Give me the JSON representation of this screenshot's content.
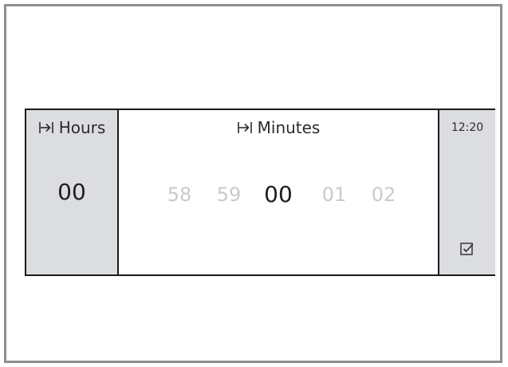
{
  "hours": {
    "header_label": "Hours",
    "value": "00"
  },
  "minutes": {
    "header_label": "Minutes",
    "options": [
      "58",
      "59",
      "00",
      "01",
      "02"
    ],
    "selected_index": 2
  },
  "status": {
    "clock": "12:20"
  },
  "icons": {
    "column_tab": "tab-arrow-icon",
    "confirm": "checkbox-check-icon"
  },
  "colors": {
    "sidebar_bg": "#dcdde1",
    "selected_text": "#1f1f1f",
    "dimmed_text": "#c9cacd",
    "border": "#1a1a1a"
  }
}
